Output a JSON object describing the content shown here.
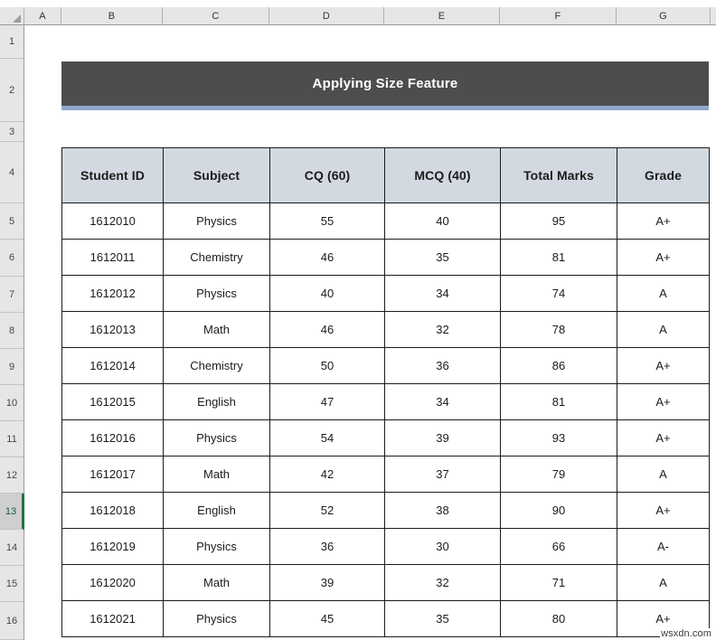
{
  "spreadsheet": {
    "column_headers": [
      "A",
      "B",
      "C",
      "D",
      "E",
      "F",
      "G"
    ],
    "row_headers": [
      "1",
      "2",
      "3",
      "4",
      "5",
      "6",
      "7",
      "8",
      "9",
      "10",
      "11",
      "12",
      "13",
      "14",
      "15",
      "16"
    ],
    "active_row": "13",
    "corner_icon": "select-all-triangle-icon"
  },
  "banner": {
    "title": "Applying Size Feature",
    "background_color": "#4D4D4D",
    "text_color": "#FFFFFF",
    "accent_border_color": "#8FA7CE"
  },
  "table": {
    "header_background_color": "#D3D9E0",
    "border_color": "#1B1B1B",
    "columns": [
      "Student ID",
      "Subject",
      "CQ  (60)",
      "MCQ  (40)",
      "Total Marks",
      "Grade"
    ],
    "rows": [
      {
        "student_id": "1612010",
        "subject": "Physics",
        "cq": "55",
        "mcq": "40",
        "total": "95",
        "grade": "A+"
      },
      {
        "student_id": "1612011",
        "subject": "Chemistry",
        "cq": "46",
        "mcq": "35",
        "total": "81",
        "grade": "A+"
      },
      {
        "student_id": "1612012",
        "subject": "Physics",
        "cq": "40",
        "mcq": "34",
        "total": "74",
        "grade": "A"
      },
      {
        "student_id": "1612013",
        "subject": "Math",
        "cq": "46",
        "mcq": "32",
        "total": "78",
        "grade": "A"
      },
      {
        "student_id": "1612014",
        "subject": "Chemistry",
        "cq": "50",
        "mcq": "36",
        "total": "86",
        "grade": "A+"
      },
      {
        "student_id": "1612015",
        "subject": "English",
        "cq": "47",
        "mcq": "34",
        "total": "81",
        "grade": "A+"
      },
      {
        "student_id": "1612016",
        "subject": "Physics",
        "cq": "54",
        "mcq": "39",
        "total": "93",
        "grade": "A+"
      },
      {
        "student_id": "1612017",
        "subject": "Math",
        "cq": "42",
        "mcq": "37",
        "total": "79",
        "grade": "A"
      },
      {
        "student_id": "1612018",
        "subject": "English",
        "cq": "52",
        "mcq": "38",
        "total": "90",
        "grade": "A+"
      },
      {
        "student_id": "1612019",
        "subject": "Physics",
        "cq": "36",
        "mcq": "30",
        "total": "66",
        "grade": "A-"
      },
      {
        "student_id": "1612020",
        "subject": "Math",
        "cq": "39",
        "mcq": "32",
        "total": "71",
        "grade": "A"
      },
      {
        "student_id": "1612021",
        "subject": "Physics",
        "cq": "45",
        "mcq": "35",
        "total": "80",
        "grade": "A+"
      }
    ]
  },
  "watermark": {
    "text": "wsxdn.com"
  }
}
